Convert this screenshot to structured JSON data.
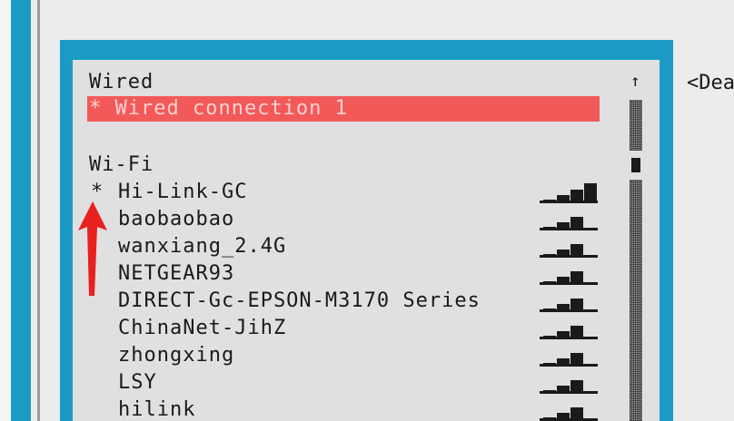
{
  "sections": {
    "wired_header": "Wired",
    "wifi_header": "Wi-Fi"
  },
  "wired": {
    "connection": "* Wired connection 1"
  },
  "wifi": {
    "active_marker": "*",
    "networks": [
      {
        "ssid": "Hi-Link-GC",
        "signal": 4
      },
      {
        "ssid": "baobaobao",
        "signal": 3
      },
      {
        "ssid": "wanxiang_2.4G",
        "signal": 3
      },
      {
        "ssid": "NETGEAR93",
        "signal": 3
      },
      {
        "ssid": "DIRECT-Gc-EPSON-M3170 Series",
        "signal": 3
      },
      {
        "ssid": "ChinaNet-JihZ",
        "signal": 3
      },
      {
        "ssid": "zhongxing",
        "signal": 3
      },
      {
        "ssid": "LSY",
        "signal": 3
      },
      {
        "ssid": "hilink",
        "signal": 3
      }
    ]
  },
  "scrollbar": {
    "up_arrow": "↑"
  },
  "side_panel": {
    "button_label": "<Dea"
  },
  "colors": {
    "accent": "#1b9bc4",
    "selection": "#f25a5a",
    "background": "#e0e0e0",
    "annotation_arrow": "#e8201e"
  },
  "icons": {
    "signal": "signal-strength-icon",
    "arrow": "red-annotation-arrow-icon"
  }
}
